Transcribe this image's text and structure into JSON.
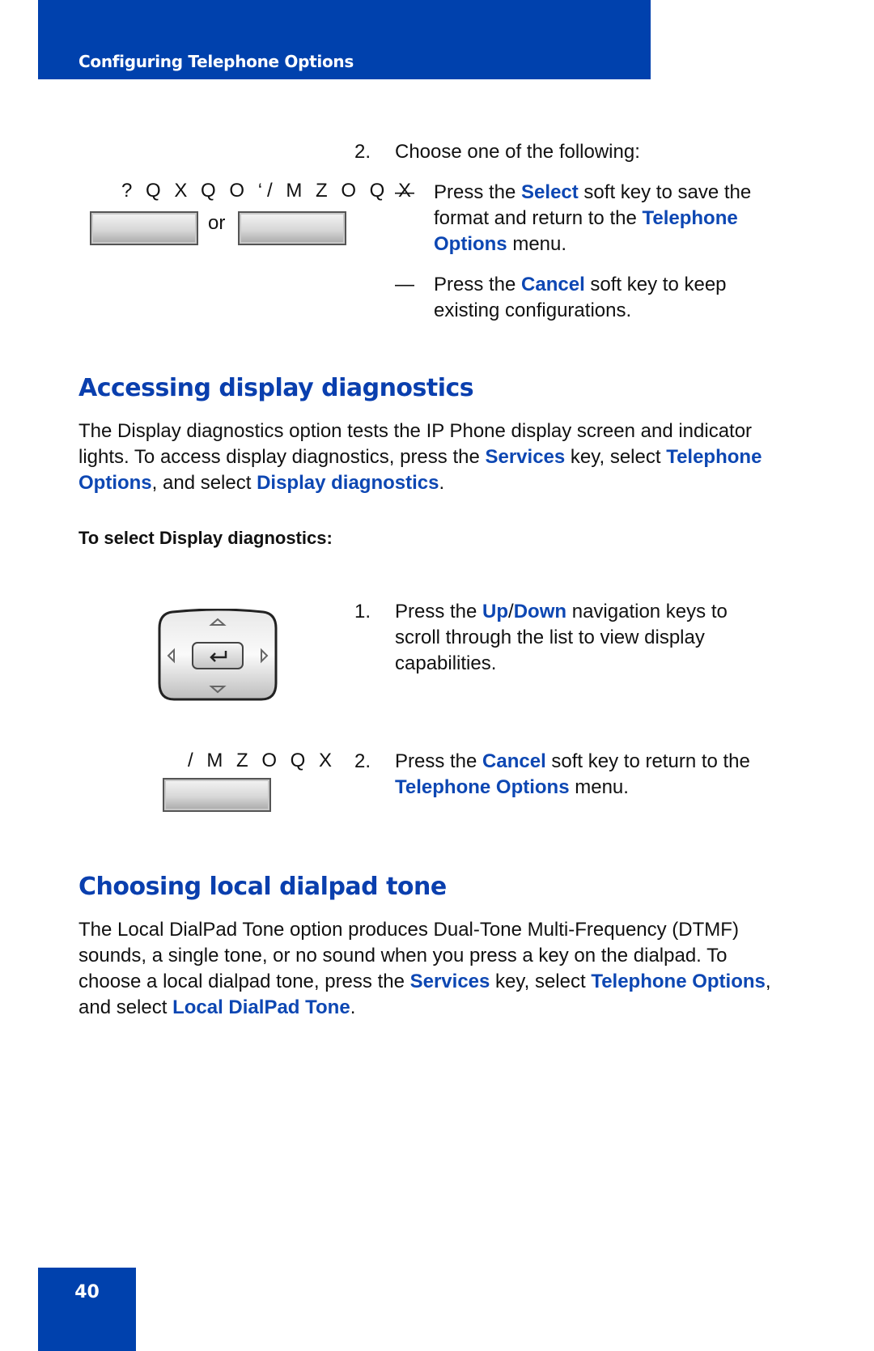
{
  "header": {
    "title": "Configuring Telephone Options"
  },
  "step2_top": {
    "number": "2.",
    "text": "Choose one of the following:",
    "softkey_label_left": "? Q X Q O ‘",
    "softkey_label_right": "/ M Z O Q X",
    "or_label": "or",
    "dash": "—",
    "option1": {
      "pre": "Press the ",
      "key": "Select",
      "mid": " soft key to save the format and return to the ",
      "menu": "Telephone Options",
      "post": " menu."
    },
    "option2": {
      "pre": "Press the ",
      "key": "Cancel",
      "post": " soft key to keep existing configurations."
    }
  },
  "section1": {
    "title": "Accessing display diagnostics",
    "para": {
      "p1": "The Display diagnostics option tests the IP Phone display screen and indicator lights. To access display diagnostics, press the ",
      "services": "Services",
      "p2": " key, select ",
      "telopts": "Telephone Options",
      "p3": ", and select ",
      "diag": "Display diagnostics",
      "p4": "."
    },
    "subhead": "To select Display diagnostics:",
    "step1": {
      "number": "1.",
      "pre": "Press the ",
      "up": "Up",
      "slash": "/",
      "down": "Down",
      "post": " navigation keys to scroll through the list to view display capabilities."
    },
    "step2": {
      "number": "2.",
      "label": "/ M Z O Q X",
      "pre": "Press the ",
      "key": "Cancel",
      "mid": " soft key to return to the ",
      "menu": "Telephone Options",
      "post": " menu."
    }
  },
  "section2": {
    "title": "Choosing local dialpad tone",
    "para": {
      "p1": "The Local DialPad Tone option produces Dual-Tone Multi-Frequency (DTMF) sounds, a single tone, or no sound when you press a key on the dialpad. To choose a local dialpad tone, press the ",
      "services": "Services",
      "p2": " key, select ",
      "telopts": "Telephone Options",
      "p3": ", and select ",
      "tone": "Local DialPad Tone",
      "p4": "."
    }
  },
  "footer": {
    "page_number": "40"
  }
}
